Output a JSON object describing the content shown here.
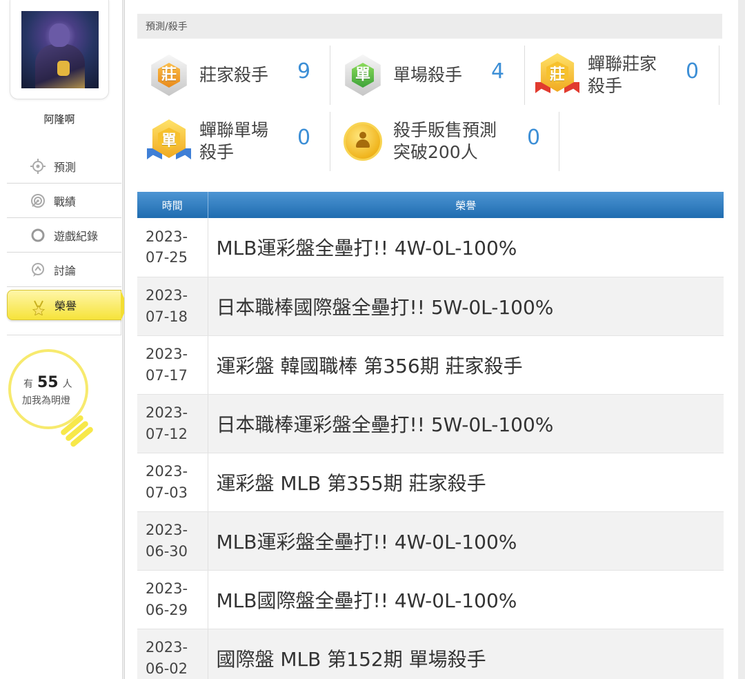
{
  "user": {
    "name": "阿隆啊",
    "avatar_icon": "thanos-avatar"
  },
  "menu": {
    "items": [
      {
        "label": "預測",
        "icon": "crosshair-icon"
      },
      {
        "label": "戰績",
        "icon": "target-icon"
      },
      {
        "label": "遊戲紀錄",
        "icon": "circle-icon"
      },
      {
        "label": "討論",
        "icon": "chat-icon"
      },
      {
        "label": "榮譽",
        "icon": "medal-icon",
        "active": true
      }
    ]
  },
  "fans": {
    "prefix": "有",
    "count": "55",
    "suffix": "人",
    "line2": "加我為明燈"
  },
  "breadcrumb": "預測/殺手",
  "stats": [
    {
      "label": "莊家殺手",
      "value": "9",
      "badge": "silver-orange",
      "glyph": "莊"
    },
    {
      "label": "單場殺手",
      "value": "4",
      "badge": "silver-green",
      "glyph": "單"
    },
    {
      "label_line1": "蟬聯莊家",
      "label_line2": "殺手",
      "value": "0",
      "badge": "gold-red-ribbon",
      "glyph": "莊"
    },
    {
      "label_line1": "蟬聯單場",
      "label_line2": "殺手",
      "value": "0",
      "badge": "gold-blue-ribbon",
      "glyph": "單"
    },
    {
      "label_line1": "殺手販售預測",
      "label_line2": "突破200人",
      "value": "0",
      "badge": "gold-coin"
    }
  ],
  "table": {
    "headers": {
      "time": "時間",
      "honor": "榮譽"
    },
    "rows": [
      {
        "date_line1": "2023-",
        "date_line2": "07-25",
        "honor": "MLB運彩盤全壘打!! 4W-0L-100%"
      },
      {
        "date_line1": "2023-",
        "date_line2": "07-18",
        "honor": "日本職棒國際盤全壘打!! 5W-0L-100%"
      },
      {
        "date_line1": "2023-",
        "date_line2": "07-17",
        "honor": "運彩盤 韓國職棒 第356期 莊家殺手"
      },
      {
        "date_line1": "2023-",
        "date_line2": "07-12",
        "honor": "日本職棒運彩盤全壘打!! 5W-0L-100%"
      },
      {
        "date_line1": "2023-",
        "date_line2": "07-03",
        "honor": "運彩盤 MLB 第355期 莊家殺手"
      },
      {
        "date_line1": "2023-",
        "date_line2": "06-30",
        "honor": "MLB運彩盤全壘打!! 4W-0L-100%"
      },
      {
        "date_line1": "2023-",
        "date_line2": "06-29",
        "honor": "MLB國際盤全壘打!! 4W-0L-100%"
      },
      {
        "date_line1": "2023-",
        "date_line2": "06-02",
        "honor": "國際盤 MLB 第152期 單場殺手"
      }
    ]
  },
  "colors": {
    "accent_blue": "#3d8fd6",
    "header_blue": "#1f6cb0",
    "active_yellow": "#f6e33a"
  }
}
